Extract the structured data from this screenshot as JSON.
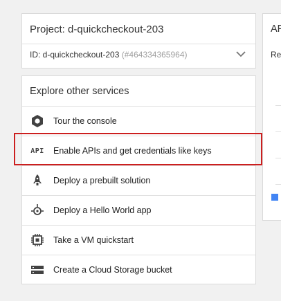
{
  "project": {
    "title": "Project: d-quickcheckout-203",
    "id_label": "ID: d-quickcheckout-203",
    "id_number": "(#464334365964)",
    "expand_icon": "chevron-down-icon"
  },
  "explore": {
    "heading": "Explore other services",
    "items": [
      {
        "label": "Tour the console",
        "icon": "hexagon-icon"
      },
      {
        "label": "Enable APIs and get credentials like keys",
        "icon": "api-icon",
        "icon_text": "API"
      },
      {
        "label": "Deploy a prebuilt solution",
        "icon": "rocket-icon"
      },
      {
        "label": "Deploy a Hello World app",
        "icon": "hello-world-icon"
      },
      {
        "label": "Take a VM quickstart",
        "icon": "chip-icon"
      },
      {
        "label": "Create a Cloud Storage bucket",
        "icon": "storage-icon"
      }
    ]
  },
  "right_panel": {
    "title": "AP",
    "subtitle": "Re"
  },
  "colors": {
    "highlight": "#cc1f1f",
    "checkbox": "#4285f4"
  }
}
